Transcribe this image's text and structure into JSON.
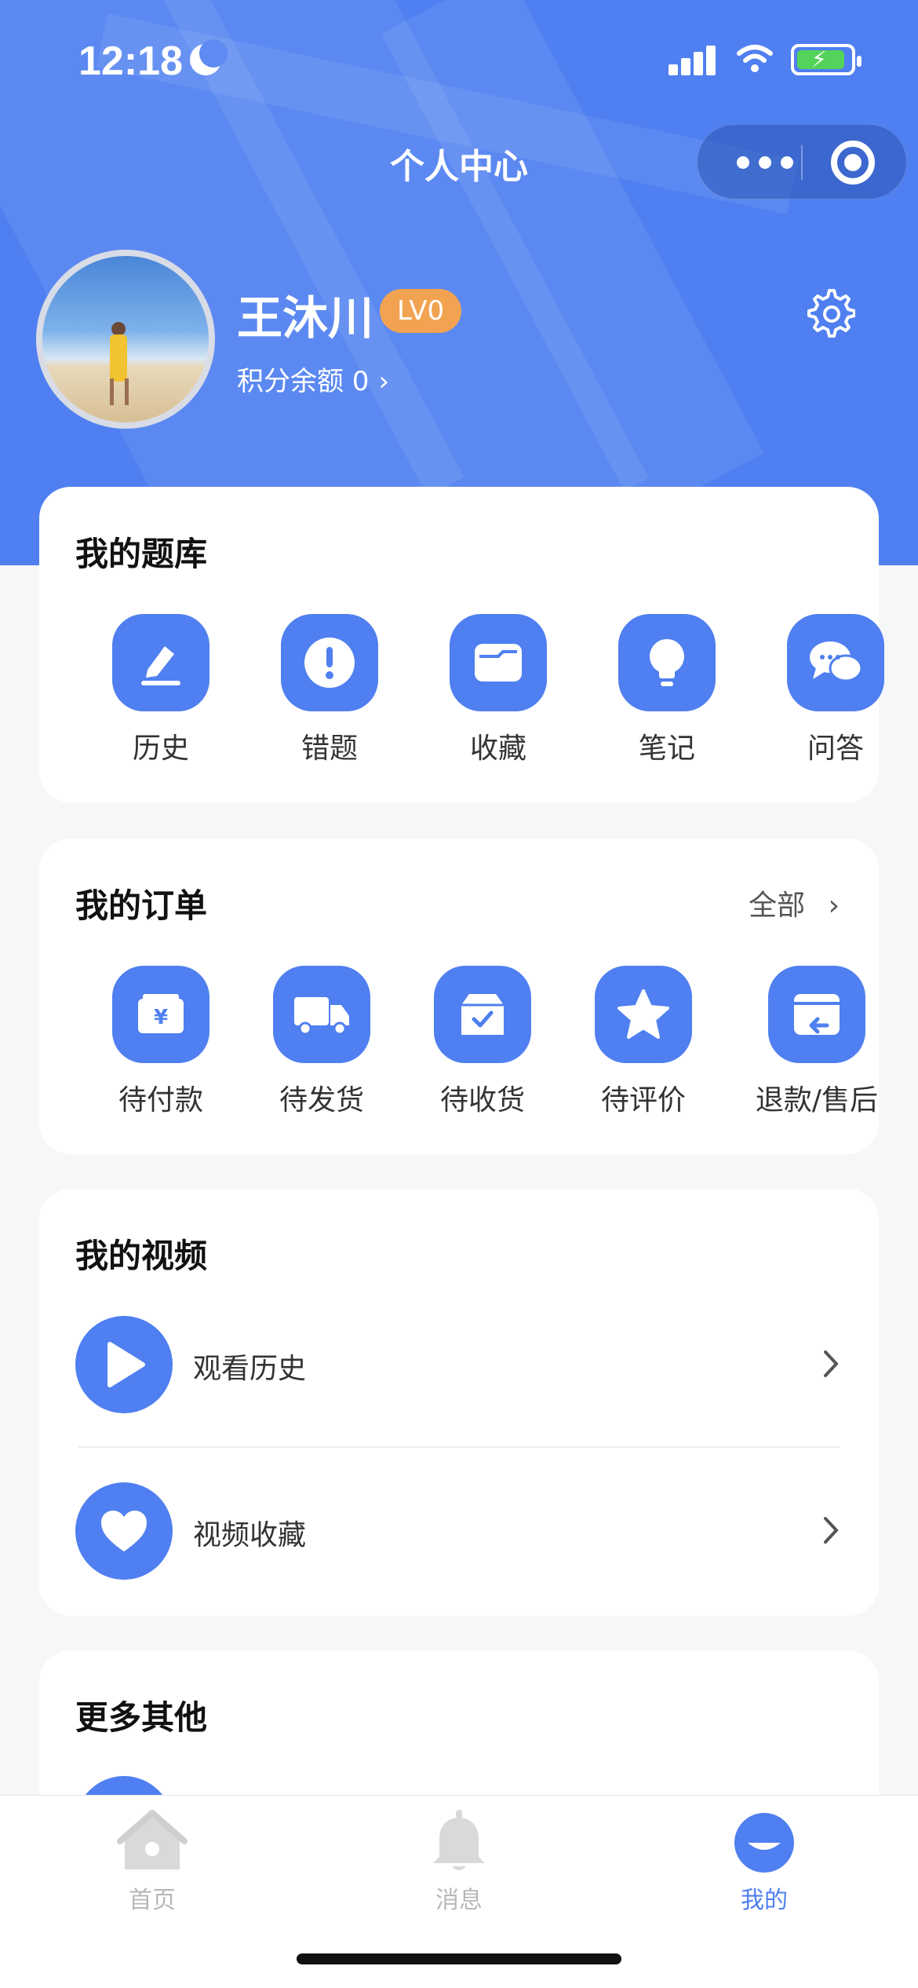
{
  "status_bar": {
    "time": "12:18"
  },
  "header": {
    "title": "个人中心",
    "user": {
      "name": "王沐川",
      "level": "LV0",
      "points_label": "积分余额 0",
      "points_chevron": "›"
    }
  },
  "question_bank": {
    "title": "我的题库",
    "items": [
      {
        "label": "历史",
        "icon": "pencil-icon"
      },
      {
        "label": "错题",
        "icon": "exclamation-icon"
      },
      {
        "label": "收藏",
        "icon": "folder-icon"
      },
      {
        "label": "笔记",
        "icon": "lightbulb-icon"
      },
      {
        "label": "问答",
        "icon": "chat-icon"
      }
    ]
  },
  "orders": {
    "title": "我的订单",
    "all_label": "全部",
    "all_chevron": "›",
    "items": [
      {
        "label": "待付款",
        "icon": "payment-icon"
      },
      {
        "label": "待发货",
        "icon": "truck-icon"
      },
      {
        "label": "待收货",
        "icon": "box-check-icon"
      },
      {
        "label": "待评价",
        "icon": "star-icon"
      },
      {
        "label": "退款/售后",
        "icon": "refund-icon"
      }
    ]
  },
  "videos": {
    "title": "我的视频",
    "items": [
      {
        "label": "观看历史",
        "icon": "play-icon"
      },
      {
        "label": "视频收藏",
        "icon": "heart-icon"
      }
    ]
  },
  "more": {
    "title": "更多其他"
  },
  "tabbar": {
    "items": [
      {
        "label": "首页",
        "icon": "home-icon",
        "active": false
      },
      {
        "label": "消息",
        "icon": "bell-icon",
        "active": false
      },
      {
        "label": "我的",
        "icon": "profile-icon",
        "active": true
      }
    ]
  },
  "colors": {
    "primary": "#4f7ff0",
    "level_badge": "#f2a351",
    "page_bg": "#f6f7f9"
  }
}
